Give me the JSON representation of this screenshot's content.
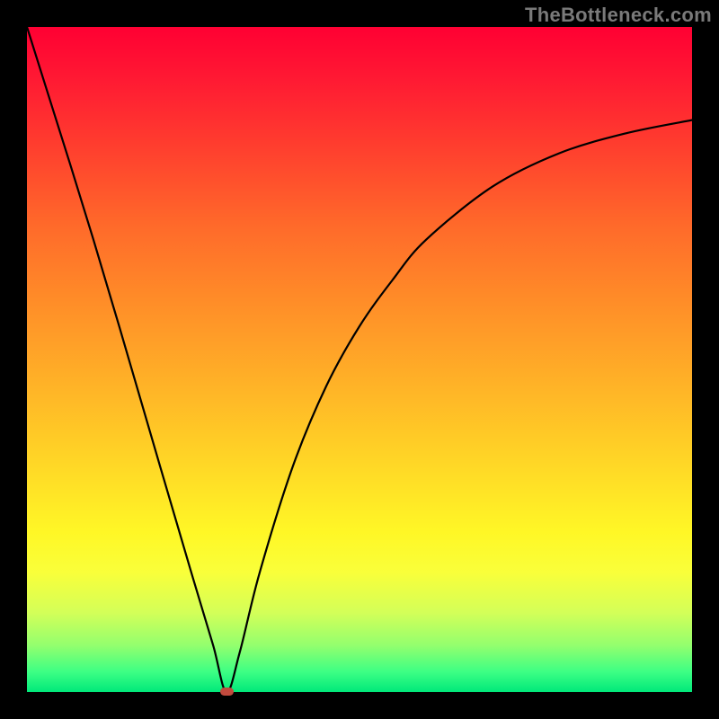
{
  "watermark": "TheBottleneck.com",
  "chart_data": {
    "type": "line",
    "title": "",
    "xlabel": "",
    "ylabel": "",
    "xlim": [
      0,
      100
    ],
    "ylim": [
      0,
      100
    ],
    "background_gradient": [
      "#ff0033",
      "#ffb327",
      "#fff726",
      "#00e87a"
    ],
    "series": [
      {
        "name": "curve",
        "x": [
          0,
          10,
          20,
          25,
          28,
          30,
          32,
          35,
          40,
          45,
          50,
          55,
          60,
          70,
          80,
          90,
          100
        ],
        "y": [
          100,
          68,
          34,
          17,
          7,
          0,
          6,
          18,
          34,
          46,
          55,
          62,
          68,
          76,
          81,
          84,
          86
        ]
      }
    ],
    "marker": {
      "x": 30,
      "y": 0,
      "color": "#c24a3e"
    }
  }
}
